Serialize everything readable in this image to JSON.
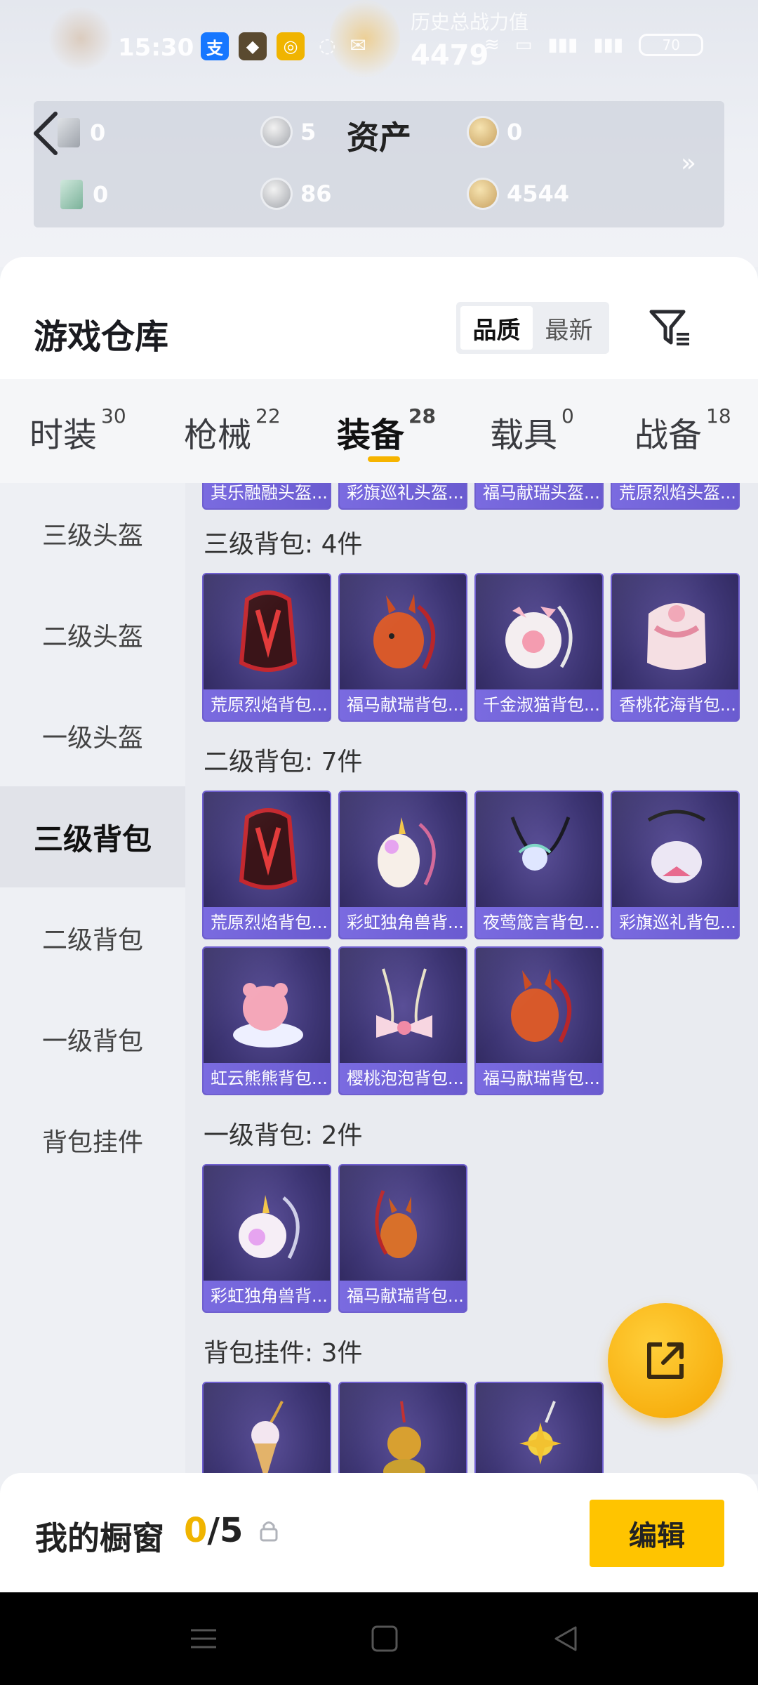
{
  "status_bar": {
    "time": "15:30",
    "bg_caption": "历史总战力值",
    "bg_number": "4479",
    "battery": "70"
  },
  "assets": {
    "title": "资产",
    "items": [
      {
        "icon": "ticket-icon",
        "value": "0"
      },
      {
        "icon": "silver-coin-icon",
        "value": "5"
      },
      {
        "icon": "gold-coin-icon",
        "value": "0"
      },
      {
        "icon": "card-icon",
        "value": "0"
      },
      {
        "icon": "silver-coin-icon",
        "value": "86"
      },
      {
        "icon": "gold-coin-icon",
        "value": "4544"
      }
    ],
    "more": "»"
  },
  "warehouse": {
    "title": "游戏仓库",
    "sort": {
      "quality": "品质",
      "latest": "最新"
    }
  },
  "tabs": [
    {
      "label": "时装",
      "count": "30"
    },
    {
      "label": "枪械",
      "count": "22"
    },
    {
      "label": "装备",
      "count": "28"
    },
    {
      "label": "载具",
      "count": "0"
    },
    {
      "label": "战备",
      "count": "18"
    }
  ],
  "sidebar": {
    "items": [
      "三级头盔",
      "二级头盔",
      "一级头盔",
      "三级背包",
      "二级背包",
      "一级背包",
      "背包挂件"
    ]
  },
  "sections": {
    "top_strip": [
      "其乐融融头盔...",
      "彩旗巡礼头盔...",
      "福马献瑞头盔...",
      "荒原烈焰头盔..."
    ],
    "lvl3_backpack": {
      "title": "三级背包: 4件",
      "items": [
        "荒原烈焰背包...",
        "福马献瑞背包...",
        "千金淑猫背包...",
        "香桃花海背包..."
      ]
    },
    "lvl2_backpack": {
      "title": "二级背包: 7件",
      "items": [
        "荒原烈焰背包...",
        "彩虹独角兽背...",
        "夜莺箴言背包...",
        "彩旗巡礼背包...",
        "虹云熊熊背包...",
        "樱桃泡泡背包...",
        "福马献瑞背包..."
      ]
    },
    "lvl1_backpack": {
      "title": "一级背包: 2件",
      "items": [
        "彩虹独角兽背...",
        "福马献瑞背包..."
      ]
    },
    "pendant": {
      "title": "背包挂件: 3件"
    }
  },
  "showcase": {
    "title": "我的橱窗",
    "count": "0",
    "total": "/5",
    "edit": "编辑"
  },
  "colors": {
    "accent": "#f6b400",
    "card_bg": "#3d3574",
    "card_label": "#7a6be0"
  }
}
